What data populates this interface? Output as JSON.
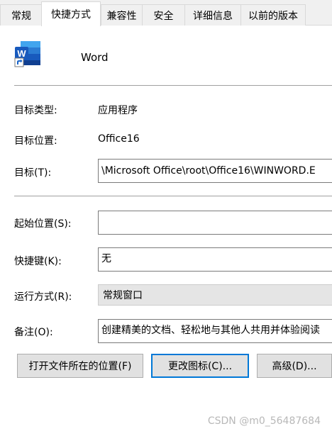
{
  "tabs": [
    {
      "label": "常规"
    },
    {
      "label": "快捷方式"
    },
    {
      "label": "兼容性"
    },
    {
      "label": "安全"
    },
    {
      "label": "详细信息"
    },
    {
      "label": "以前的版本"
    }
  ],
  "app": {
    "name": "Word",
    "icon": "word-shortcut-icon"
  },
  "fields": {
    "target_type": {
      "label": "目标类型:",
      "value": "应用程序"
    },
    "target_location": {
      "label": "目标位置:",
      "value": "Office16"
    },
    "target": {
      "label": "目标(T):",
      "value": "\\Microsoft Office\\root\\Office16\\WINWORD.E"
    },
    "start_in": {
      "label": "起始位置(S):",
      "value": ""
    },
    "shortcut_key": {
      "label": "快捷键(K):",
      "value": "无"
    },
    "run": {
      "label": "运行方式(R):",
      "value": "常规窗口"
    },
    "comment": {
      "label": "备注(O):",
      "value": "创建精美的文档、轻松地与其他人共用并体验阅读"
    }
  },
  "buttons": {
    "open_location": "打开文件所在的位置(F)",
    "change_icon": "更改图标(C)...",
    "advanced": "高级(D)..."
  },
  "watermark": "CSDN @m0_56487684",
  "colors": {
    "word_blue": "#185abd",
    "focus": "#0078d7",
    "tab_bg": "#f0f0f0"
  }
}
